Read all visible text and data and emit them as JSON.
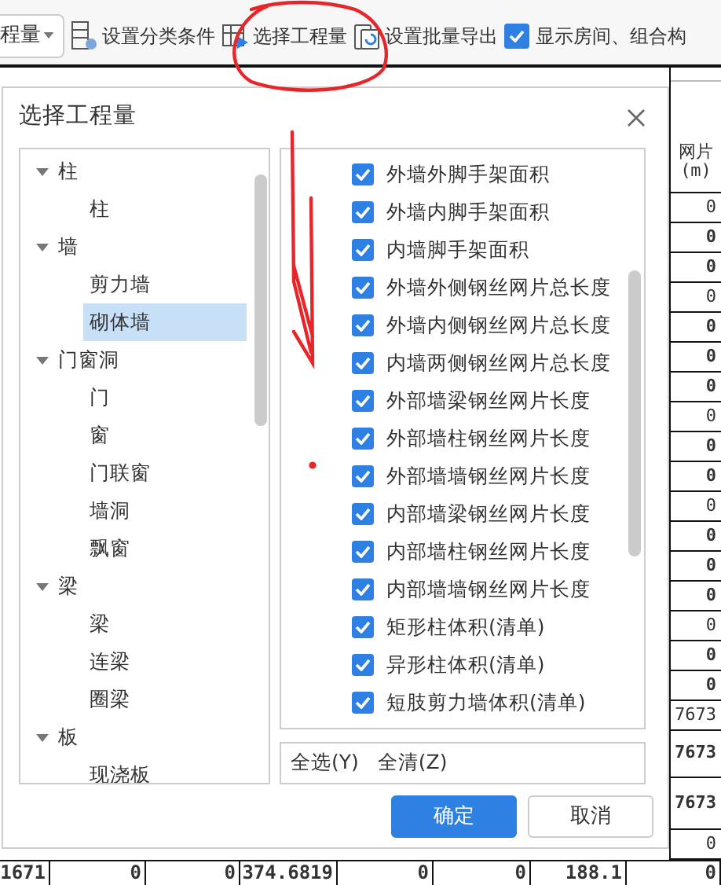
{
  "toolbar": {
    "dropdown": {
      "value": "程量"
    },
    "buttons": [
      {
        "kind": "conditions",
        "label": "设置分类条件"
      },
      {
        "kind": "select",
        "label": "选择工程量"
      },
      {
        "kind": "export",
        "label": "设置批量导出"
      }
    ],
    "checkbox": {
      "label": "显示房间、组合构",
      "checked": true
    }
  },
  "sheet": {
    "column_header": [
      "网片",
      "(m)"
    ],
    "rows": [
      {
        "value": "0",
        "bold": false
      },
      {
        "value": "0",
        "bold": true
      },
      {
        "value": "0",
        "bold": true
      },
      {
        "value": "0",
        "bold": false
      },
      {
        "value": "0",
        "bold": true
      },
      {
        "value": "0",
        "bold": true
      },
      {
        "value": "0",
        "bold": true
      },
      {
        "value": "0",
        "bold": false
      },
      {
        "value": "0",
        "bold": true
      },
      {
        "value": "0",
        "bold": true
      },
      {
        "value": "0",
        "bold": false
      },
      {
        "value": "0",
        "bold": true
      },
      {
        "value": "0",
        "bold": true
      },
      {
        "value": "0",
        "bold": true
      },
      {
        "value": "0",
        "bold": false
      },
      {
        "value": "0",
        "bold": true
      },
      {
        "value": "0",
        "bold": true
      },
      {
        "value": "7673",
        "bold": false
      },
      {
        "value": "7673",
        "bold": true
      },
      {
        "value": "7673",
        "bold": true
      },
      {
        "value": "0",
        "bold": false
      }
    ],
    "bottom_row": [
      "1671",
      "0",
      "0",
      "374.6819",
      "0",
      "0",
      "188.1",
      "0"
    ]
  },
  "dialog": {
    "title": "选择工程量",
    "tree": [
      {
        "label": "柱",
        "expanded": true,
        "children": [
          {
            "label": "柱",
            "selected": false
          }
        ]
      },
      {
        "label": "墙",
        "expanded": true,
        "children": [
          {
            "label": "剪力墙",
            "selected": false
          },
          {
            "label": "砌体墙",
            "selected": true
          }
        ]
      },
      {
        "label": "门窗洞",
        "expanded": true,
        "children": [
          {
            "label": "门",
            "selected": false
          },
          {
            "label": "窗",
            "selected": false
          },
          {
            "label": "门联窗",
            "selected": false
          },
          {
            "label": "墙洞",
            "selected": false
          },
          {
            "label": "飘窗",
            "selected": false
          }
        ]
      },
      {
        "label": "梁",
        "expanded": true,
        "children": [
          {
            "label": "梁",
            "selected": false
          },
          {
            "label": "连梁",
            "selected": false
          },
          {
            "label": "圈梁",
            "selected": false
          }
        ]
      },
      {
        "label": "板",
        "expanded": true,
        "children": [
          {
            "label": "现浇板",
            "selected": false
          }
        ]
      }
    ],
    "items": [
      {
        "label": "外墙外脚手架面积",
        "checked": true
      },
      {
        "label": "外墙内脚手架面积",
        "checked": true
      },
      {
        "label": "内墙脚手架面积",
        "checked": true
      },
      {
        "label": "外墙外侧钢丝网片总长度",
        "checked": true
      },
      {
        "label": "外墙内侧钢丝网片总长度",
        "checked": true
      },
      {
        "label": "内墙两侧钢丝网片总长度",
        "checked": true
      },
      {
        "label": "外部墙梁钢丝网片长度",
        "checked": true
      },
      {
        "label": "外部墙柱钢丝网片长度",
        "checked": true
      },
      {
        "label": "外部墙墙钢丝网片长度",
        "checked": true
      },
      {
        "label": "内部墙梁钢丝网片长度",
        "checked": true
      },
      {
        "label": "内部墙柱钢丝网片长度",
        "checked": true
      },
      {
        "label": "内部墙墙钢丝网片长度",
        "checked": true
      },
      {
        "label": "矩形柱体积(清单)",
        "checked": true
      },
      {
        "label": "异形柱体积(清单)",
        "checked": true
      },
      {
        "label": "短肢剪力墙体积(清单)",
        "checked": true
      }
    ],
    "links": [
      "全选(Y)",
      "全清(Z)"
    ],
    "buttons": [
      {
        "label": "确定",
        "kind": "primary"
      },
      {
        "label": "取消",
        "kind": "secondary"
      }
    ]
  }
}
